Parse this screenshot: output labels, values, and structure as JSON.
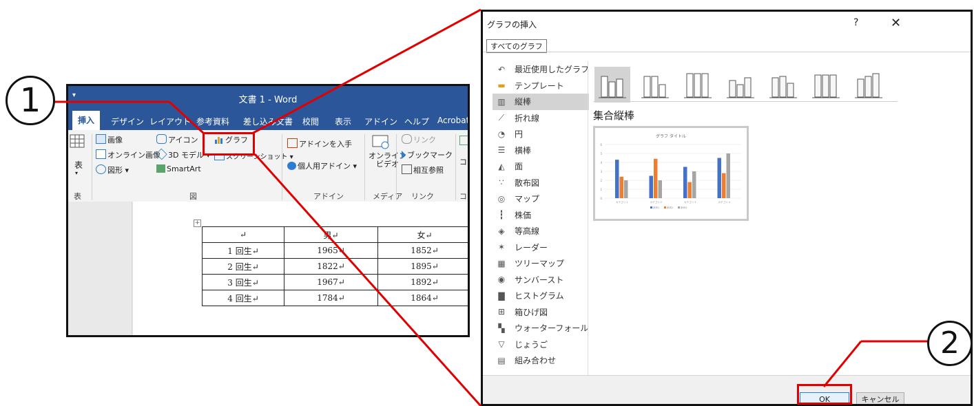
{
  "word": {
    "title": "文書 1  -  Word",
    "qa_arrow": "▾",
    "tabs": [
      {
        "label": "挿入",
        "active": true
      },
      {
        "label": "デザイン"
      },
      {
        "label": "レイアウト"
      },
      {
        "label": "参考資料"
      },
      {
        "label": "差し込み文書"
      },
      {
        "label": "校閲"
      },
      {
        "label": "表示"
      },
      {
        "label": "アドイン"
      },
      {
        "label": "ヘルプ"
      },
      {
        "label": "Acrobat"
      }
    ],
    "ribbon": {
      "table_label": "表",
      "image": "画像",
      "online_image": "オンライン画像",
      "shapes": "図形",
      "icons": "アイコン",
      "model3d": "3D モデル",
      "smartart": "SmartArt",
      "chart": "グラフ",
      "screenshot": "スクリーンショット",
      "get_addins": "アドインを入手",
      "my_addins": "個人用アドイン",
      "online_video_1": "オンライン",
      "online_video_2": "ビデオ",
      "link": "リンク",
      "bookmark": "ブックマーク",
      "crossref": "相互参照",
      "comment": "コメ",
      "groups": {
        "table": "表",
        "figure": "図",
        "addin": "アドイン",
        "media": "メディア",
        "links": "リンク",
        "comment": "コメ"
      }
    },
    "table": {
      "header": [
        "↵",
        "男↵",
        "女↵"
      ],
      "rows": [
        [
          "1 回生↵",
          "1965↵",
          "1852↵"
        ],
        [
          "2 回生↵",
          "1822↵",
          "1895↵"
        ],
        [
          "3 回生↵",
          "1967↵",
          "1892↵"
        ],
        [
          "4 回生↵",
          "1784↵",
          "1864↵"
        ]
      ]
    }
  },
  "dialog": {
    "title": "グラフの挿入",
    "help": "?",
    "close": "✕",
    "tab": "すべてのグラフ",
    "chart_types": [
      {
        "label": "最近使用したグラフ",
        "icon": "recent-icon"
      },
      {
        "label": "テンプレート",
        "icon": "folder-icon"
      },
      {
        "label": "縦棒",
        "icon": "column-chart-icon",
        "selected": true
      },
      {
        "label": "折れ線",
        "icon": "line-chart-icon"
      },
      {
        "label": "円",
        "icon": "pie-chart-icon"
      },
      {
        "label": "横棒",
        "icon": "bar-chart-icon"
      },
      {
        "label": "面",
        "icon": "area-chart-icon"
      },
      {
        "label": "散布図",
        "icon": "scatter-chart-icon"
      },
      {
        "label": "マップ",
        "icon": "map-chart-icon"
      },
      {
        "label": "株価",
        "icon": "stock-chart-icon"
      },
      {
        "label": "等高線",
        "icon": "surface-chart-icon"
      },
      {
        "label": "レーダー",
        "icon": "radar-chart-icon"
      },
      {
        "label": "ツリーマップ",
        "icon": "treemap-chart-icon"
      },
      {
        "label": "サンバースト",
        "icon": "sunburst-chart-icon"
      },
      {
        "label": "ヒストグラム",
        "icon": "histogram-chart-icon"
      },
      {
        "label": "箱ひげ図",
        "icon": "boxwhisker-chart-icon"
      },
      {
        "label": "ウォーターフォール",
        "icon": "waterfall-chart-icon"
      },
      {
        "label": "じょうご",
        "icon": "funnel-chart-icon"
      },
      {
        "label": "組み合わせ",
        "icon": "combo-chart-icon"
      }
    ],
    "subtypes": [
      "clustered-column",
      "stacked-column",
      "100-stacked-column",
      "3d-clustered-column",
      "3d-stacked-column",
      "3d-100-stacked-column",
      "3d-column"
    ],
    "selected_subtype_title": "集合縦棒",
    "ok": "OK",
    "cancel": "キャンセル"
  },
  "chart_data": {
    "type": "bar",
    "title": "グラフ タイトル",
    "categories": [
      "カテゴリ 1",
      "カテゴリ 2",
      "カテゴリ 3",
      "カテゴリ 4"
    ],
    "series": [
      {
        "name": "系列1",
        "values": [
          4.3,
          2.5,
          3.5,
          4.5
        ],
        "color": "#4472c4"
      },
      {
        "name": "系列2",
        "values": [
          2.4,
          4.4,
          1.8,
          2.8
        ],
        "color": "#ed7d31"
      },
      {
        "name": "系列3",
        "values": [
          2,
          2,
          3,
          5
        ],
        "color": "#a5a5a5"
      }
    ],
    "ylim": [
      0,
      6
    ],
    "yticks": [
      0,
      1,
      2,
      3,
      4,
      5,
      6
    ],
    "legend": "bottom",
    "grid": true
  },
  "annotations": {
    "step1": "1",
    "step2": "2",
    "callout_color": "#e00000"
  }
}
